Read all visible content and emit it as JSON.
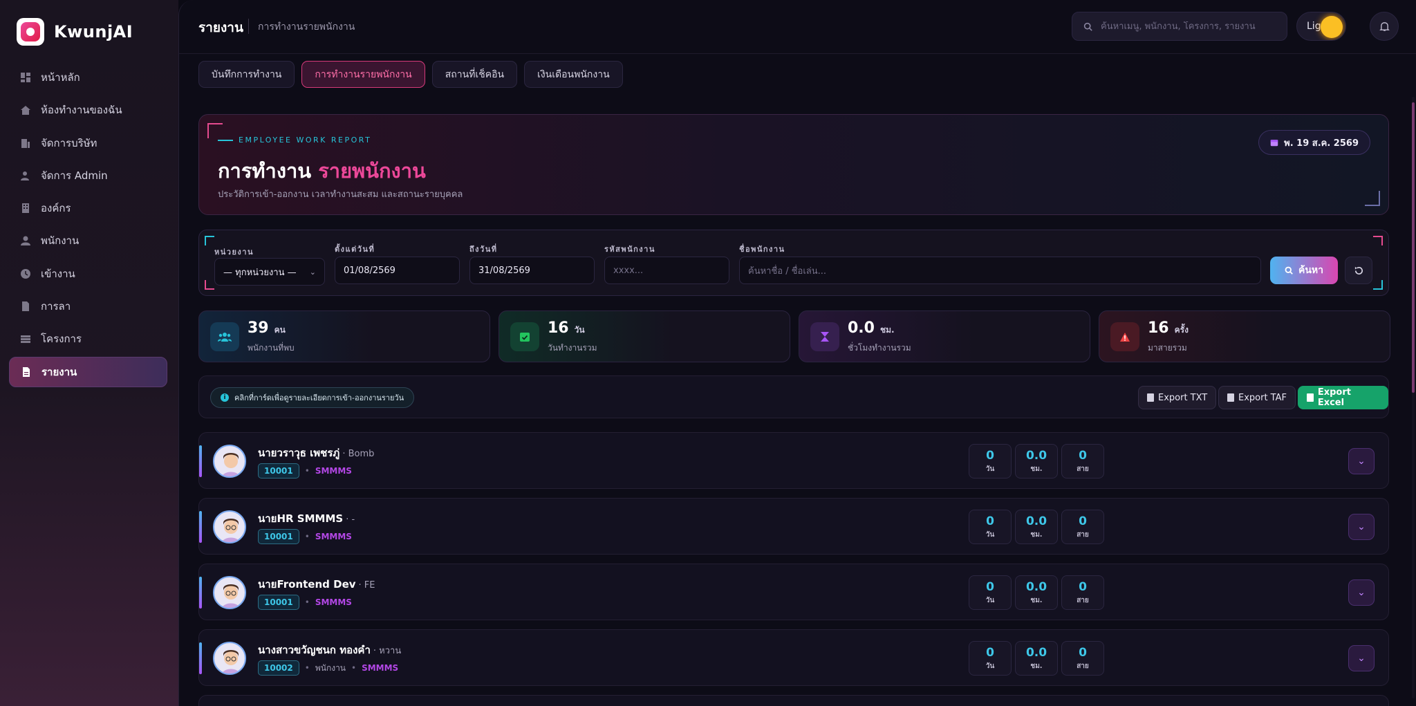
{
  "brand": {
    "name": "KwunjAI"
  },
  "sidebar": {
    "items": [
      {
        "label": "หน้าหลัก",
        "icon": "dashboard-icon"
      },
      {
        "label": "ห้องทำงานของฉัน",
        "icon": "home-icon"
      },
      {
        "label": "จัดการบริษัท",
        "icon": "building-icon"
      },
      {
        "label": "จัดการ Admin",
        "icon": "user-cog-icon"
      },
      {
        "label": "องค์กร",
        "icon": "office-icon"
      },
      {
        "label": "พนักงาน",
        "icon": "user-icon"
      },
      {
        "label": "เข้างาน",
        "icon": "clock-icon"
      },
      {
        "label": "การลา",
        "icon": "file-icon"
      },
      {
        "label": "โครงการ",
        "icon": "folder-icon"
      },
      {
        "label": "รายงาน",
        "icon": "report-icon",
        "active": true
      }
    ]
  },
  "header": {
    "title": "รายงาน",
    "subtitle": "การทำงานรายพนักงาน",
    "search_placeholder": "ค้นหาเมนู, พนักงาน, โครงการ, รายงาน",
    "theme_label": "Light"
  },
  "tabs": [
    {
      "label": "บันทึกการทำงาน"
    },
    {
      "label": "การทำงานรายพนักงาน",
      "active": true
    },
    {
      "label": "สถานที่เช็คอิน"
    },
    {
      "label": "เงินเดือนพนักงาน"
    }
  ],
  "hero": {
    "eyebrow": "EMPLOYEE WORK REPORT",
    "title_main": "การทำงาน",
    "title_accent": "รายพนักงาน",
    "description": "ประวัติการเข้า-ออกงาน เวลาทำงานสะสม และสถานะรายบุคคล",
    "date": "พ. 19 ส.ค. 2569"
  },
  "filter": {
    "unit_label": "หน่วยงาน",
    "unit_value": "— ทุกหน่วยงาน —",
    "from_label": "ตั้งแต่วันที่",
    "from_value": "01/08/2569",
    "to_label": "ถึงวันที่",
    "to_value": "31/08/2569",
    "code_label": "รหัสพนักงาน",
    "code_placeholder": "xxxx...",
    "name_label": "ชื่อพนักงาน",
    "name_placeholder": "ค้นหาชื่อ / ชื่อเล่น...",
    "search_button": "ค้นหา"
  },
  "stats": [
    {
      "value": "39",
      "unit": "คน",
      "label": "พนักงานที่พบ",
      "color": "#27c4d9"
    },
    {
      "value": "16",
      "unit": "วัน",
      "label": "วันทำงานรวม",
      "color": "#22c55e"
    },
    {
      "value": "0.0",
      "unit": "ชม.",
      "label": "ชั่วโมงทำงานรวม",
      "color": "#a855f7"
    },
    {
      "value": "16",
      "unit": "ครั้ง",
      "label": "มาสายรวม",
      "color": "#ef4444"
    }
  ],
  "exportbar": {
    "hint": "คลิกที่การ์ดเพื่อดูรายละเอียดการเข้า-ออกงานรายวัน",
    "export_txt": "Export TXT",
    "export_taf": "Export TAF",
    "export_excel": "Export Excel"
  },
  "employees": [
    {
      "name": "นายวราวุธ เพชรภู่",
      "nick": "· Bomb",
      "code": "10001",
      "role": "",
      "dept": "SMMMS",
      "days": "0",
      "hours": "0.0",
      "late": "0"
    },
    {
      "name": "นายHR SMMMS",
      "nick": "· -",
      "code": "10001",
      "role": "",
      "dept": "SMMMS",
      "days": "0",
      "hours": "0.0",
      "late": "0"
    },
    {
      "name": "นายFrontend Dev",
      "nick": "· FE",
      "code": "10001",
      "role": "",
      "dept": "SMMMS",
      "days": "0",
      "hours": "0.0",
      "late": "0"
    },
    {
      "name": "นางสาวขวัญชนก ทองคำ",
      "nick": "· หวาน",
      "code": "10002",
      "role": "พนักงาน",
      "dept": "SMMMS",
      "days": "0",
      "hours": "0.0",
      "late": "0"
    }
  ],
  "mini_labels": {
    "days": "วัน",
    "hours": "ชม.",
    "late": "สาย"
  }
}
